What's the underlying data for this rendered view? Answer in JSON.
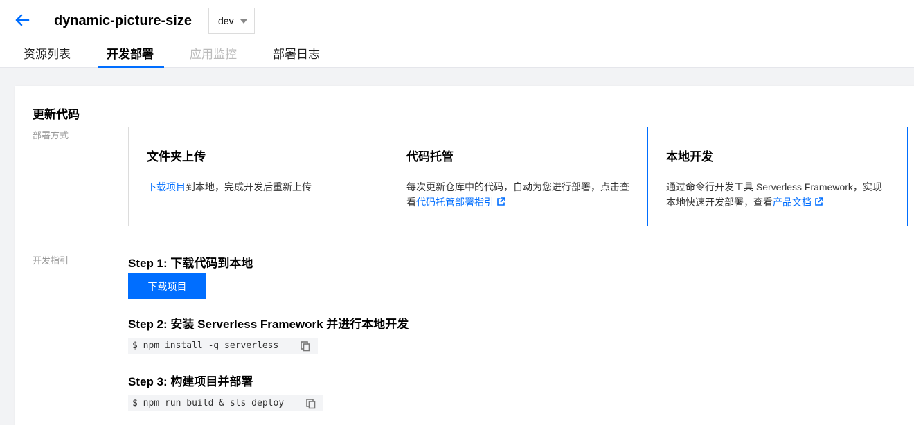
{
  "header": {
    "app_name": "dynamic-picture-size",
    "env": {
      "selected": "dev"
    },
    "tabs": [
      {
        "label": "资源列表",
        "state": "normal"
      },
      {
        "label": "开发部署",
        "state": "active"
      },
      {
        "label": "应用监控",
        "state": "disabled"
      },
      {
        "label": "部署日志",
        "state": "normal"
      }
    ]
  },
  "main": {
    "section_title": "更新代码",
    "deploy_label": "部署方式",
    "guide_label": "开发指引",
    "options": [
      {
        "title": "文件夹上传",
        "link_text": "下载项目",
        "text_after": "到本地，完成开发后重新上传"
      },
      {
        "title": "代码托管",
        "text_before": "每次更新仓库中的代码，自动为您进行部署，点击查看",
        "link_text": "代码托管部署指引"
      },
      {
        "title": "本地开发",
        "text_before": "通过命令行开发工具 Serverless Framework，实现本地快速开发部署，查看",
        "link_text": "产品文档"
      }
    ],
    "steps": [
      {
        "title": "Step 1: 下载代码到本地",
        "button_label": "下载项目"
      },
      {
        "title": "Step 2: 安装 Serverless Framework 并进行本地开发",
        "command": "$ npm install -g serverless"
      },
      {
        "title": "Step 3: 构建项目并部署",
        "command": "$ npm run build & sls deploy"
      }
    ]
  },
  "icons": {
    "back": "arrow-left-icon",
    "caret": "caret-down-icon",
    "external": "external-link-icon",
    "copy": "copy-icon"
  },
  "colors": {
    "accent": "#006eff",
    "selected_border": "#006eff",
    "muted_label": "#999999"
  }
}
